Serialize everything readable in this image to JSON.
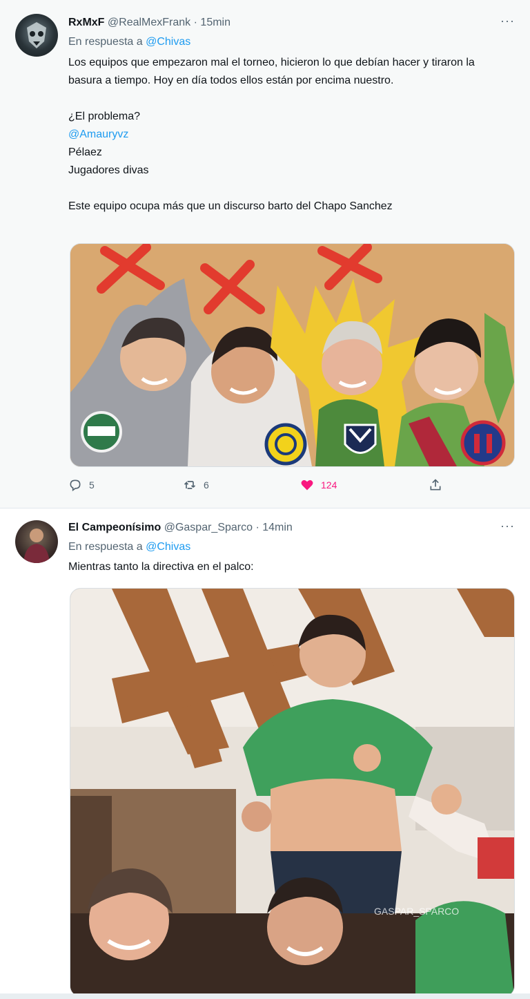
{
  "tweets": [
    {
      "name": "RxMxF",
      "handle": "@RealMexFrank",
      "time": "· 15min",
      "more": "···",
      "reply_prefix": "En respuesta a",
      "reply_to": "@Chivas",
      "lines": [
        "Los equipos que empezaron mal el torneo, hicieron lo que debían hacer y tiraron la basura a tiempo. Hoy en día todos ellos están por encima nuestro.",
        "¿El problema?",
        "@Amauryvz",
        "Pélaez",
        "Jugadores divas",
        "Este equipo ocupa más que un discurso barto del Chapo Sanchez"
      ],
      "counts": {
        "replies": "5",
        "retweets": "6",
        "likes": "124"
      }
    },
    {
      "name": "El Campeonísimo",
      "handle": "@Gaspar_Sparco",
      "time": "· 14min",
      "more": "···",
      "reply_prefix": "En respuesta a",
      "reply_to": "@Chivas",
      "lines": [
        "Mientras tanto la directiva en el palco:"
      ],
      "watermark": "GASPAR_SPARCO"
    }
  ],
  "colors": {
    "accent": "#1d9bf0",
    "like": "#f91880",
    "muted": "#536471"
  },
  "icons": {
    "reply": "speech-bubble-icon",
    "retweet": "retweet-icon",
    "like": "heart-icon",
    "share": "share-icon",
    "more": "more-dots-icon"
  }
}
